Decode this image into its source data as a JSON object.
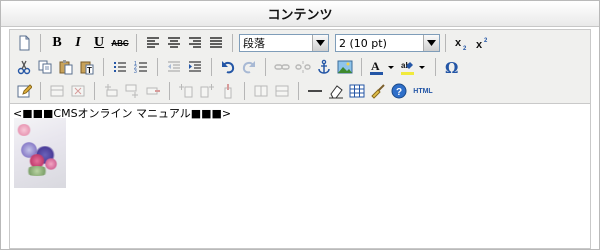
{
  "panel": {
    "title": "コンテンツ"
  },
  "toolbar": {
    "format_select": {
      "selected": "段落"
    },
    "fontsize_select": {
      "selected": "2 (10 pt)"
    },
    "bold_label": "B",
    "italic_label": "I",
    "underline_label": "U",
    "strike_label": "ABC",
    "html_label": "HTML"
  },
  "editor": {
    "content_text": "<■■■CMSオンライン マニュアル■■■>"
  },
  "colors": {
    "toolbar_bg": "#f0f0ee",
    "border": "#c9c9c9",
    "accent_blue": "#2456a6"
  }
}
